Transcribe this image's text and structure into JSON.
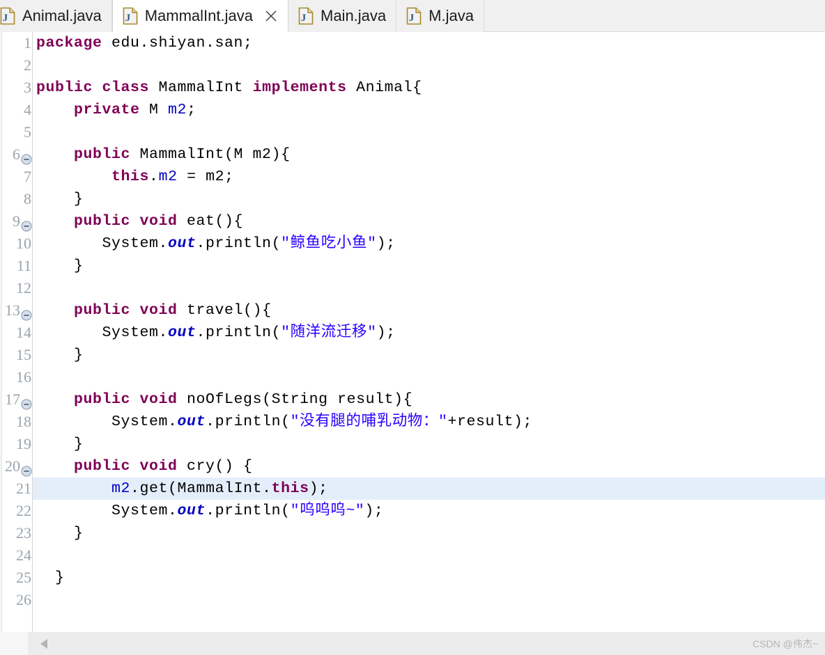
{
  "window": {
    "app": "Eclipse IDE Java Editor"
  },
  "tabs": [
    {
      "label": "Animal.java",
      "icon": "java-file-icon",
      "active": false,
      "closable": false
    },
    {
      "label": "MammalInt.java",
      "icon": "java-file-icon",
      "active": true,
      "closable": true
    },
    {
      "label": "Main.java",
      "icon": "java-file-icon",
      "active": false,
      "closable": false
    },
    {
      "label": "M.java",
      "icon": "java-file-icon",
      "active": false,
      "closable": false
    }
  ],
  "editor": {
    "highlighted_line": 21,
    "colors": {
      "keyword": "#7f0055",
      "string": "#2a00ff",
      "field": "#0000c0",
      "static_field": "#0000c0",
      "line_number": "#9aa4ad",
      "current_line_highlight": "#e4eefb",
      "gutter_border": "#d6d6d6",
      "tab_active_bg": "#ffffff",
      "tab_inactive_bg": "#f0f0f0"
    },
    "lines": [
      {
        "n": 1,
        "fold": false,
        "tokens": [
          {
            "t": "kw",
            "v": "package"
          },
          {
            "t": "plain",
            "v": " edu.shiyan.san;"
          }
        ]
      },
      {
        "n": 2,
        "fold": false,
        "tokens": []
      },
      {
        "n": 3,
        "fold": false,
        "tokens": [
          {
            "t": "kw",
            "v": "public class"
          },
          {
            "t": "plain",
            "v": " MammalInt "
          },
          {
            "t": "kw",
            "v": "implements"
          },
          {
            "t": "plain",
            "v": " Animal{"
          }
        ]
      },
      {
        "n": 4,
        "fold": false,
        "tokens": [
          {
            "t": "plain",
            "v": "    "
          },
          {
            "t": "kw",
            "v": "private"
          },
          {
            "t": "plain",
            "v": " M "
          },
          {
            "t": "fld",
            "v": "m2"
          },
          {
            "t": "plain",
            "v": ";"
          }
        ]
      },
      {
        "n": 5,
        "fold": false,
        "tokens": []
      },
      {
        "n": 6,
        "fold": true,
        "tokens": [
          {
            "t": "plain",
            "v": "    "
          },
          {
            "t": "kw",
            "v": "public"
          },
          {
            "t": "plain",
            "v": " MammalInt(M m2){"
          }
        ]
      },
      {
        "n": 7,
        "fold": false,
        "tokens": [
          {
            "t": "plain",
            "v": "        "
          },
          {
            "t": "kw",
            "v": "this"
          },
          {
            "t": "plain",
            "v": "."
          },
          {
            "t": "fld",
            "v": "m2"
          },
          {
            "t": "plain",
            "v": " = m2;"
          }
        ]
      },
      {
        "n": 8,
        "fold": false,
        "tokens": [
          {
            "t": "plain",
            "v": "    }"
          }
        ]
      },
      {
        "n": 9,
        "fold": true,
        "tokens": [
          {
            "t": "plain",
            "v": "    "
          },
          {
            "t": "kw",
            "v": "public void"
          },
          {
            "t": "plain",
            "v": " eat(){"
          }
        ]
      },
      {
        "n": 10,
        "fold": false,
        "tokens": [
          {
            "t": "plain",
            "v": "       System."
          },
          {
            "t": "stat",
            "v": "out"
          },
          {
            "t": "plain",
            "v": ".println("
          },
          {
            "t": "str",
            "v": "\"鲸鱼吃小鱼\""
          },
          {
            "t": "plain",
            "v": ");"
          }
        ]
      },
      {
        "n": 11,
        "fold": false,
        "tokens": [
          {
            "t": "plain",
            "v": "    }"
          }
        ]
      },
      {
        "n": 12,
        "fold": false,
        "tokens": []
      },
      {
        "n": 13,
        "fold": true,
        "tokens": [
          {
            "t": "plain",
            "v": "    "
          },
          {
            "t": "kw",
            "v": "public void"
          },
          {
            "t": "plain",
            "v": " travel(){"
          }
        ]
      },
      {
        "n": 14,
        "fold": false,
        "tokens": [
          {
            "t": "plain",
            "v": "       System."
          },
          {
            "t": "stat",
            "v": "out"
          },
          {
            "t": "plain",
            "v": ".println("
          },
          {
            "t": "str",
            "v": "\"随洋流迁移\""
          },
          {
            "t": "plain",
            "v": ");"
          }
        ]
      },
      {
        "n": 15,
        "fold": false,
        "tokens": [
          {
            "t": "plain",
            "v": "    }"
          }
        ]
      },
      {
        "n": 16,
        "fold": false,
        "tokens": []
      },
      {
        "n": 17,
        "fold": true,
        "tokens": [
          {
            "t": "plain",
            "v": "    "
          },
          {
            "t": "kw",
            "v": "public void"
          },
          {
            "t": "plain",
            "v": " noOfLegs(String result){"
          }
        ]
      },
      {
        "n": 18,
        "fold": false,
        "tokens": [
          {
            "t": "plain",
            "v": "        System."
          },
          {
            "t": "stat",
            "v": "out"
          },
          {
            "t": "plain",
            "v": ".println("
          },
          {
            "t": "str",
            "v": "\"没有腿的哺乳动物："
          },
          {
            "t": "str",
            "v": "\""
          },
          {
            "t": "plain",
            "v": "+result);"
          }
        ]
      },
      {
        "n": 19,
        "fold": false,
        "tokens": [
          {
            "t": "plain",
            "v": "    }"
          }
        ]
      },
      {
        "n": 20,
        "fold": true,
        "tokens": [
          {
            "t": "plain",
            "v": "    "
          },
          {
            "t": "kw",
            "v": "public void"
          },
          {
            "t": "plain",
            "v": " cry() {"
          }
        ]
      },
      {
        "n": 21,
        "fold": false,
        "tokens": [
          {
            "t": "plain",
            "v": "        "
          },
          {
            "t": "fld",
            "v": "m2"
          },
          {
            "t": "plain",
            "v": ".get(MammalInt."
          },
          {
            "t": "kw",
            "v": "this"
          },
          {
            "t": "plain",
            "v": ");"
          }
        ]
      },
      {
        "n": 22,
        "fold": false,
        "tokens": [
          {
            "t": "plain",
            "v": "        System."
          },
          {
            "t": "stat",
            "v": "out"
          },
          {
            "t": "plain",
            "v": ".println("
          },
          {
            "t": "str",
            "v": "\"呜呜呜~\""
          },
          {
            "t": "plain",
            "v": ");"
          }
        ]
      },
      {
        "n": 23,
        "fold": false,
        "tokens": [
          {
            "t": "plain",
            "v": "    }"
          }
        ]
      },
      {
        "n": 24,
        "fold": false,
        "tokens": []
      },
      {
        "n": 25,
        "fold": false,
        "tokens": [
          {
            "t": "plain",
            "v": "  }"
          }
        ]
      },
      {
        "n": 26,
        "fold": false,
        "tokens": []
      }
    ]
  },
  "statusbar": {
    "watermark": "CSDN @伟杰~",
    "scroll_left_icon": "scroll-left-arrow-icon"
  }
}
